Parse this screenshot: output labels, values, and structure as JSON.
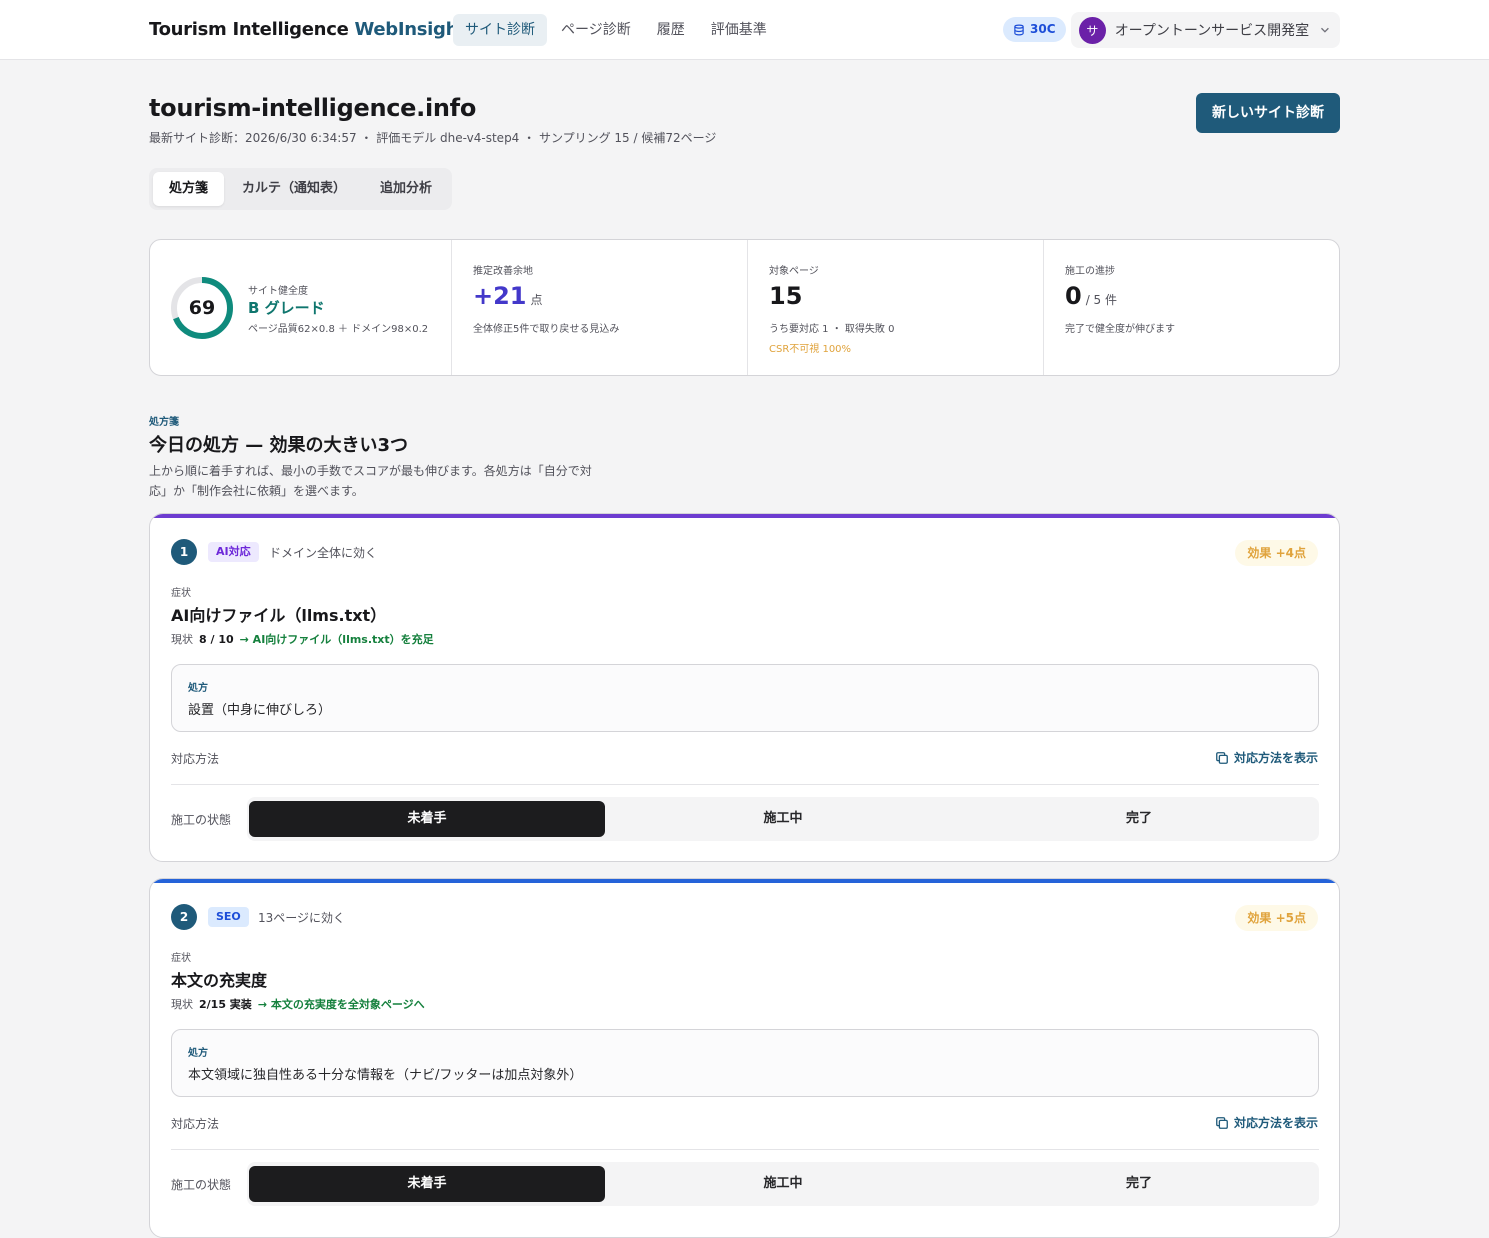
{
  "header": {
    "brand_main": "Tourism Intelligence",
    "brand_accent": "WebInsights",
    "nav": [
      "サイト診断",
      "ページ診断",
      "履歴",
      "評価基準"
    ],
    "credits": "30C",
    "org_initial": "サ",
    "org_name": "オープントーンサービス開発室"
  },
  "page": {
    "title": "tourism-intelligence.info",
    "meta": "最新サイト診断：2026/6/30 6:34:57 ・ 評価モデル dhe-v4-step4 ・ サンプリング 15 / 候補72ページ",
    "new_button": "新しいサイト診断"
  },
  "tabs": [
    "処方箋",
    "カルテ（通知表）",
    "追加分析"
  ],
  "metrics": {
    "health": {
      "score": "69",
      "score_value": 69,
      "label": "サイト健全度",
      "grade": "B グレード",
      "formula": "ページ品質62×0.8 ＋ ドメイン98×0.2"
    },
    "improve": {
      "label": "推定改善余地",
      "value": "+21",
      "unit": "点",
      "sub": "全体修正5件で取り戻せる見込み"
    },
    "pages": {
      "label": "対象ページ",
      "value": "15",
      "sub": "うち要対応 1 ・ 取得失敗 0",
      "warn": "CSR不可視 100%"
    },
    "progress": {
      "label": "施工の進捗",
      "value": "0",
      "unit": "/ 5 件",
      "sub": "完了で健全度が伸びます"
    }
  },
  "section": {
    "eyebrow": "処方箋",
    "title": "今日の処方 — 効果の大きい3つ",
    "desc": "上から順に着手すれば、最小の手数でスコアが最も伸びます。各処方は「自分で対応」か「制作会社に依頼」を選べます。"
  },
  "colors": {
    "brand": "#1f5a7a",
    "ai": "#6d3cd0",
    "seo": "#2563d9",
    "effect": "#e0a33c"
  },
  "prescriptions": [
    {
      "num": "1",
      "category": "AI対応",
      "scope": "ドメイン全体に効く",
      "effect": "効果 +4点",
      "symptom_label": "症状",
      "symptom": "AI向けファイル（llms.txt）",
      "current_label": "現状",
      "current_value": "8 / 10",
      "goal": "→ AI向けファイル（llms.txt）を充足",
      "rx_label": "処方",
      "rx_text": "設置（中身に伸びしろ）",
      "method_label": "対応方法",
      "method_link": "対応方法を表示",
      "status_label": "施工の状態",
      "status_options": [
        "未着手",
        "施工中",
        "完了"
      ]
    },
    {
      "num": "2",
      "category": "SEO",
      "scope": "13ページに効く",
      "effect": "効果 +5点",
      "symptom_label": "症状",
      "symptom": "本文の充実度",
      "current_label": "現状",
      "current_value": "2/15 実装",
      "goal": "→ 本文の充実度を全対象ページへ",
      "rx_label": "処方",
      "rx_text": "本文領域に独自性ある十分な情報を（ナビ/フッターは加点対象外）",
      "method_label": "対応方法",
      "method_link": "対応方法を表示",
      "status_label": "施工の状態",
      "status_options": [
        "未着手",
        "施工中",
        "完了"
      ]
    }
  ]
}
